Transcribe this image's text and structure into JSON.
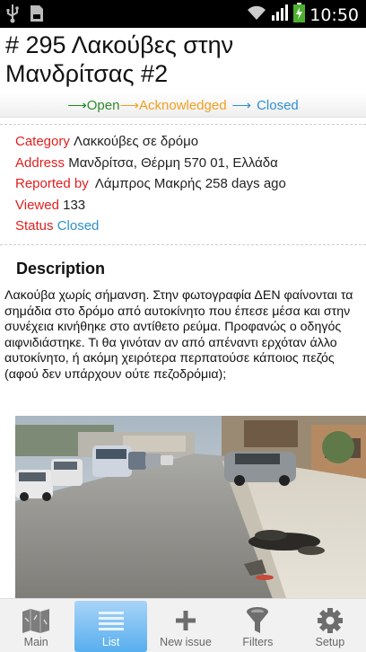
{
  "status_bar": {
    "time": "10:50"
  },
  "issue": {
    "title": "# 295 Λακούβες στην Μανδρίτσας #2",
    "workflow": {
      "open": "Open",
      "acknowledged": "Acknowledged",
      "closed": "Closed"
    },
    "fields": {
      "category_label": "Category",
      "category_value": "Λακκούβες σε δρόμο",
      "address_label": "Address",
      "address_value": "Μανδρίτσα, Θέρμη 570 01, Ελλάδα",
      "reported_label": "Reported by",
      "reported_value": "Λάμπρος Μακρής 258 days ago",
      "viewed_label": "Viewed",
      "viewed_value": "133",
      "status_label": "Status",
      "status_value": "Closed"
    },
    "description_heading": "Description",
    "description": "Λακούβα χωρίς σήμανση. Στην φωτογραφία ΔΕΝ φαίνονται τα σημάδια στο δρόμο από αυτοκίνητο που έπεσε μέσα και στην συνέχεια κινήθηκε στο αντίθετο ρεύμα. Προφανώς ο οδηγός αιφνιδιάστηκε. Τι θα γινόταν αν από απέναντι ερχόταν άλλο αυτοκίνητο, ή ακόμη χειρότερα περπατούσε κάποιος πεζός (αφού δεν υπάρχουν ούτε πεζοδρόμια);"
  },
  "nav": {
    "main": "Main",
    "list": "List",
    "new_issue": "New issue",
    "filters": "Filters",
    "setup": "Setup"
  },
  "colors": {
    "label_red": "#e02020",
    "status_blue": "#2f8fd0",
    "open_green": "#2e8b2e",
    "acknowledged_orange": "#f0a020",
    "active_tab": "#57aeee"
  }
}
